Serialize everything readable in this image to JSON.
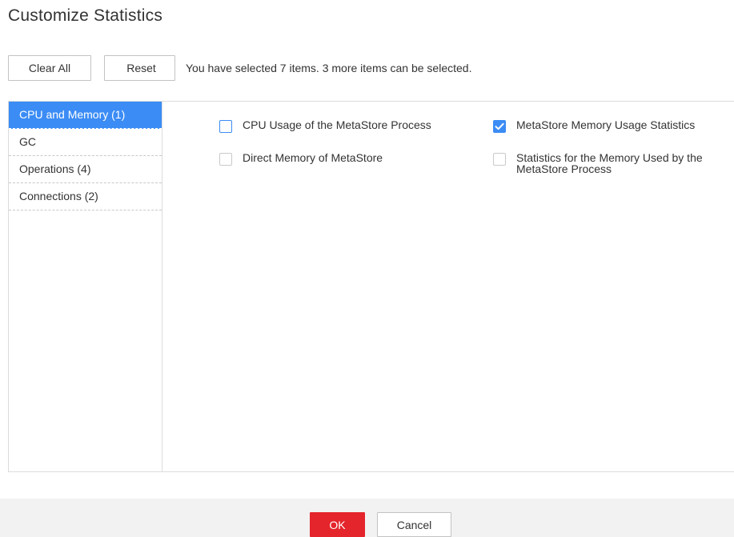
{
  "dialog": {
    "title": "Customize Statistics"
  },
  "toolbar": {
    "clear_all_label": "Clear All",
    "reset_label": "Reset",
    "selection_info": "You have selected 7 items. 3 more items can be selected."
  },
  "sidebar": {
    "items": [
      {
        "label": "CPU and Memory (1)",
        "active": true
      },
      {
        "label": "GC",
        "active": false
      },
      {
        "label": "Operations (4)",
        "active": false
      },
      {
        "label": "Connections (2)",
        "active": false
      }
    ]
  },
  "options": [
    {
      "label": "CPU Usage of the MetaStore Process",
      "checked": false
    },
    {
      "label": "MetaStore Memory Usage Statistics",
      "checked": true
    },
    {
      "label": "Direct Memory of MetaStore",
      "checked": false
    },
    {
      "label": "Statistics for the Memory Used by the MetaStore Process",
      "checked": false
    }
  ],
  "footer": {
    "ok_label": "OK",
    "cancel_label": "Cancel"
  },
  "colors": {
    "accent": "#3b8cf5",
    "primary_button": "#e4252b",
    "footer_background": "#f2f2f2"
  },
  "icons": {
    "checkbox_checked": "check-icon"
  }
}
